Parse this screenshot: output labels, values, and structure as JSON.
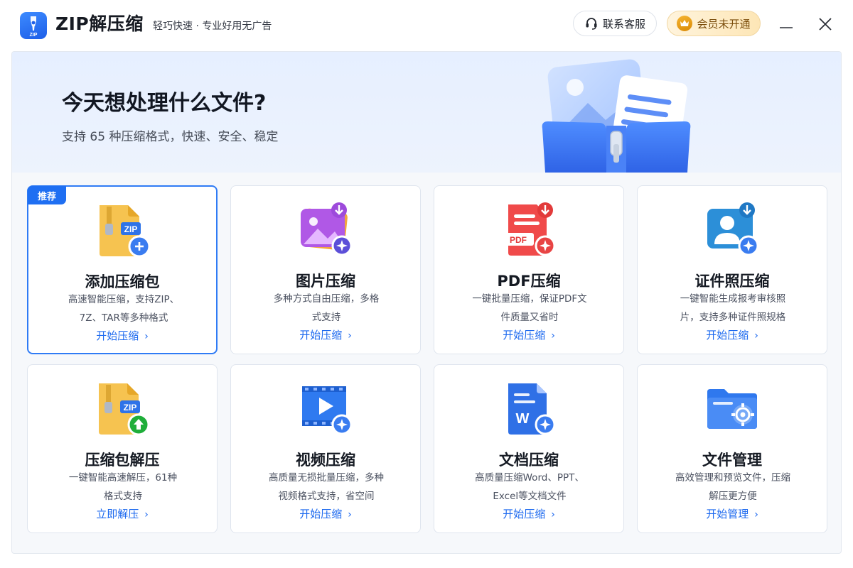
{
  "app": {
    "name": "ZIP解压缩",
    "slogan": "轻巧快速 · 专业好用无广告",
    "logo_text": "ZIP"
  },
  "header": {
    "support_label": "联系客服",
    "vip_label": "会员未开通",
    "support_icon": "headset-icon",
    "vip_icon": "crown-icon",
    "minimize_icon": "minimize-icon",
    "close_icon": "close-icon"
  },
  "banner": {
    "title": "今天想处理什么文件?",
    "subtitle": "支持 65 种压缩格式，快速、安全、稳定"
  },
  "colors": {
    "accent": "#1c69ef",
    "featured_border": "#2f7bf5",
    "badge": "#1f6ff2",
    "vip": "#7a4c0a"
  },
  "cards": [
    {
      "title": "添加压缩包",
      "desc_line1": "高速智能压缩，支持ZIP、",
      "desc_line2": "7Z、TAR等多种格式",
      "link": "开始压缩",
      "badge": "推荐",
      "icon": "zip-add-icon"
    },
    {
      "title": "图片压缩",
      "desc_line1": "多种方式自由压缩，多格",
      "desc_line2": "式支持",
      "link": "开始压缩",
      "icon": "image-compress-icon"
    },
    {
      "title": "PDF压缩",
      "desc_line1": "一键批量压缩，保证PDF文",
      "desc_line2": "件质量又省时",
      "link": "开始压缩",
      "icon": "pdf-compress-icon",
      "pdf_text": "PDF"
    },
    {
      "title": "证件照压缩",
      "desc_line1": "一键智能生成报考审核照",
      "desc_line2": "片，支持多种证件照规格",
      "link": "开始压缩",
      "icon": "id-photo-icon"
    },
    {
      "title": "压缩包解压",
      "desc_line1": "一键智能高速解压，61种",
      "desc_line2": "格式支持",
      "link": "立即解压",
      "icon": "zip-extract-icon"
    },
    {
      "title": "视频压缩",
      "desc_line1": "高质量无损批量压缩，多种",
      "desc_line2": "视频格式支持，省空间",
      "link": "开始压缩",
      "icon": "video-compress-icon"
    },
    {
      "title": "文档压缩",
      "desc_line1": "高质量压缩Word、PPT、",
      "desc_line2": "Excel等文档文件",
      "link": "开始压缩",
      "icon": "word-compress-icon",
      "doc_text": "W"
    },
    {
      "title": "文件管理",
      "desc_line1": "高效管理和预览文件，压缩",
      "desc_line2": "解压更方便",
      "link": "开始管理",
      "icon": "folder-settings-icon"
    }
  ]
}
